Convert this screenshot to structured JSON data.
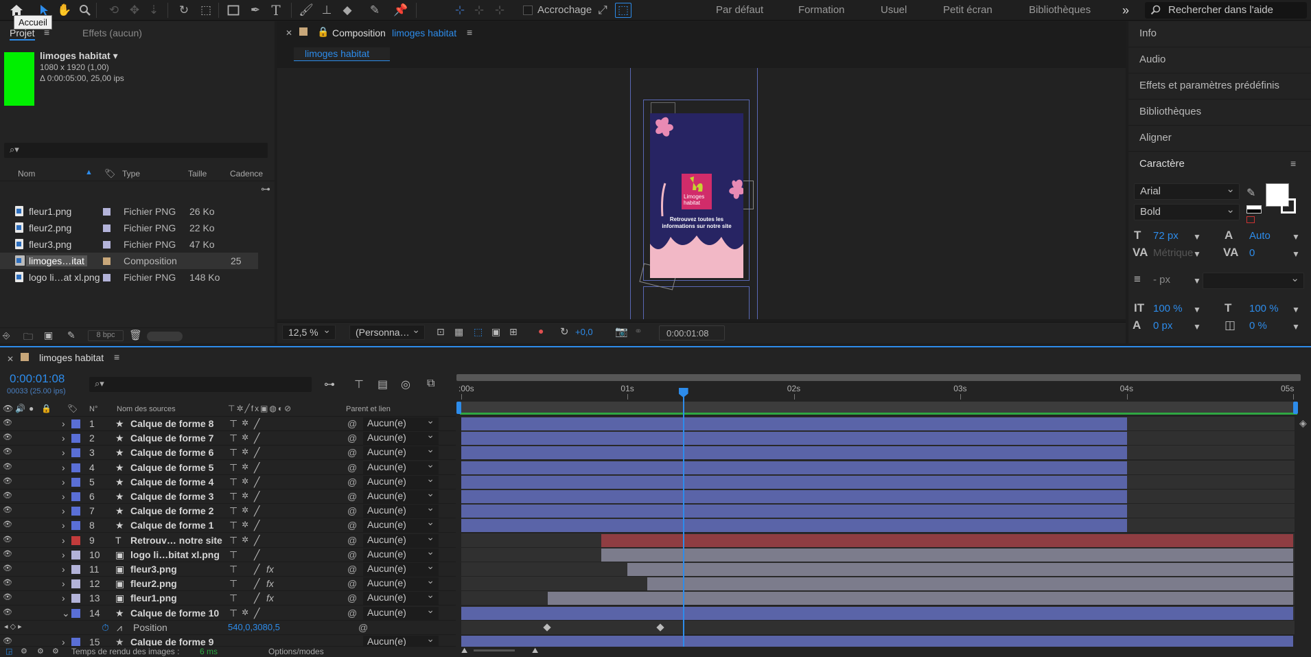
{
  "toolbar": {
    "tooltip": "Accueil",
    "snapping_label": "Accrochage",
    "workspaces": [
      "Par défaut",
      "Formation",
      "Usuel",
      "Petit écran",
      "Bibliothèques"
    ],
    "more_glyph": "»",
    "help_placeholder": "Rechercher dans l'aide",
    "tools": [
      "home-icon",
      "selection-tool-icon",
      "hand-tool-icon",
      "zoom-tool-icon",
      "orbit-camera-icon",
      "pan-camera-icon",
      "dolly-camera-icon",
      "rotate-tool-icon",
      "pan-behind-icon",
      "rectangle-tool-icon",
      "pen-tool-icon",
      "type-tool-icon",
      "brush-tool-icon",
      "clone-stamp-icon",
      "eraser-tool-icon",
      "roto-brush-icon",
      "puppet-pin-icon"
    ]
  },
  "project": {
    "tab": "Projet",
    "effects_tab": "Effets (aucun)",
    "selected_name": "limoges habitat ▾",
    "selected_dims": "1080 x 1920 (1,00)",
    "selected_duration": "Δ 0:00:05:00, 25,00 ips",
    "columns": [
      "Nom",
      "Type",
      "Taille",
      "Cadence"
    ],
    "items": [
      {
        "name": "fleur1.png",
        "type": "Fichier PNG",
        "size": "26 Ko",
        "rate": "",
        "color": "#b3b3d9"
      },
      {
        "name": "fleur2.png",
        "type": "Fichier PNG",
        "size": "22 Ko",
        "rate": "",
        "color": "#b3b3d9"
      },
      {
        "name": "fleur3.png",
        "type": "Fichier PNG",
        "size": "47 Ko",
        "rate": "",
        "color": "#b3b3d9"
      },
      {
        "name": "limoges…itat",
        "type": "Composition",
        "size": "",
        "rate": "25",
        "color": "#c8a77a"
      },
      {
        "name": "logo li…at xl.png",
        "type": "Fichier PNG",
        "size": "148 Ko",
        "rate": "",
        "color": "#b3b3d9"
      }
    ],
    "bpc": "8 bpc"
  },
  "composition": {
    "tab_prefix": "Composition",
    "tab_name": "limoges habitat",
    "crumb": "limoges habitat",
    "zoom": "12,5 %",
    "resolution": "(Personna…",
    "exposure": "+0,0",
    "timecode": "0:00:01:08",
    "preview": {
      "logo_line1": "Limoges",
      "logo_line2": "habitat",
      "cta_line1": "Retrouvez toutes les",
      "cta_line2": "informations sur notre site"
    }
  },
  "right_panel": {
    "items": [
      "Info",
      "Audio",
      "Effets et paramètres prédéfinis",
      "Bibliothèques",
      "Aligner"
    ],
    "character_title": "Caractère",
    "font": "Arial",
    "style": "Bold",
    "font_size": "72 px",
    "leading": "Auto",
    "kerning": "Métrique",
    "tracking": "0",
    "stroke": "- px",
    "vscale": "100 %",
    "hscale": "100 %",
    "baseline": "0 px",
    "tsume": "0 %"
  },
  "timeline": {
    "tab": "limoges habitat",
    "timecode": "0:00:01:08",
    "frames": "00033 (25.00 ips)",
    "col_num": "N°",
    "col_source": "Nom des sources",
    "col_parent": "Parent et lien",
    "ruler": [
      ":00s",
      "01s",
      "02s",
      "03s",
      "04s",
      "05s"
    ],
    "playhead_fraction": 0.267,
    "layers": [
      {
        "n": "1",
        "name": "Calque de forme 8",
        "kind": "shape",
        "color": "#5a6fd6",
        "parent": "Aucun(e)",
        "start": 0.0,
        "end": 0.8,
        "bar": "blue"
      },
      {
        "n": "2",
        "name": "Calque de forme 7",
        "kind": "shape",
        "color": "#5a6fd6",
        "parent": "Aucun(e)",
        "start": 0.0,
        "end": 0.8,
        "bar": "blue"
      },
      {
        "n": "3",
        "name": "Calque de forme 6",
        "kind": "shape",
        "color": "#5a6fd6",
        "parent": "Aucun(e)",
        "start": 0.0,
        "end": 0.8,
        "bar": "blue"
      },
      {
        "n": "4",
        "name": "Calque de forme 5",
        "kind": "shape",
        "color": "#5a6fd6",
        "parent": "Aucun(e)",
        "start": 0.0,
        "end": 0.8,
        "bar": "blue"
      },
      {
        "n": "5",
        "name": "Calque de forme 4",
        "kind": "shape",
        "color": "#5a6fd6",
        "parent": "Aucun(e)",
        "start": 0.0,
        "end": 0.8,
        "bar": "blue"
      },
      {
        "n": "6",
        "name": "Calque de forme 3",
        "kind": "shape",
        "color": "#5a6fd6",
        "parent": "Aucun(e)",
        "start": 0.0,
        "end": 0.8,
        "bar": "blue"
      },
      {
        "n": "7",
        "name": "Calque de forme 2",
        "kind": "shape",
        "color": "#5a6fd6",
        "parent": "Aucun(e)",
        "start": 0.0,
        "end": 0.8,
        "bar": "blue"
      },
      {
        "n": "8",
        "name": "Calque de forme 1",
        "kind": "shape",
        "color": "#5a6fd6",
        "parent": "Aucun(e)",
        "start": 0.0,
        "end": 0.8,
        "bar": "blue"
      },
      {
        "n": "9",
        "name": "Retrouv… notre site",
        "kind": "text",
        "color": "#c23b3b",
        "parent": "Aucun(e)",
        "start": 0.168,
        "end": 1.0,
        "bar": "red"
      },
      {
        "n": "10",
        "name": "logo li…bitat xl.png",
        "kind": "file",
        "color": "#b3b3d9",
        "parent": "Aucun(e)",
        "start": 0.168,
        "end": 1.0,
        "bar": "grey"
      },
      {
        "n": "11",
        "name": "fleur3.png",
        "kind": "file",
        "color": "#b3b3d9",
        "parent": "Aucun(e)",
        "start": 0.2,
        "end": 1.0,
        "bar": "grey"
      },
      {
        "n": "12",
        "name": "fleur2.png",
        "kind": "file",
        "color": "#b3b3d9",
        "parent": "Aucun(e)",
        "start": 0.224,
        "end": 1.0,
        "bar": "grey"
      },
      {
        "n": "13",
        "name": "fleur1.png",
        "kind": "file",
        "color": "#b3b3d9",
        "parent": "Aucun(e)",
        "start": 0.104,
        "end": 1.0,
        "bar": "grey"
      },
      {
        "n": "14",
        "name": "Calque de forme 10",
        "kind": "shape",
        "color": "#5a6fd6",
        "parent": "Aucun(e)",
        "start": 0.0,
        "end": 1.0,
        "bar": "blue"
      }
    ],
    "property": {
      "name": "Position",
      "value": "540,0,3080,5",
      "keyframes": [
        0.104,
        0.24
      ]
    },
    "partial_layer": {
      "n": "15",
      "name": "Calque de forme 9",
      "parent": "Aucun(e)"
    },
    "footer_render": "Temps de rendu des images :",
    "footer_render_ms": "6 ms",
    "footer_modes": "Options/modes"
  }
}
